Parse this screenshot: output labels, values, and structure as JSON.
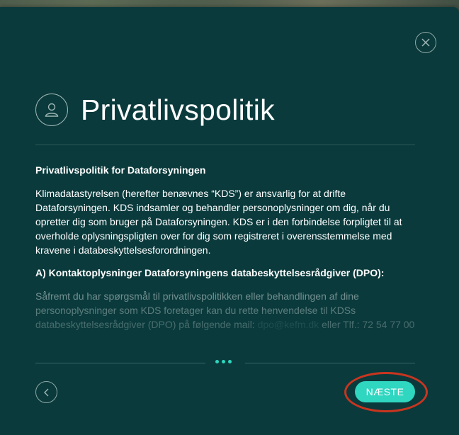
{
  "dialog": {
    "title": "Privatlivspolitik",
    "close_icon": "close-icon",
    "user_icon": "user-icon"
  },
  "content": {
    "heading": "Privatlivspolitik for Dataforsyningen",
    "paragraph1": "Klimadatastyrelsen (herefter benævnes “KDS”) er ansvarlig for at drifte Dataforsyningen. KDS indsamler og behandler personoplysninger om dig, når du opretter dig som bruger på Dataforsyningen. KDS er i den forbindelse forpligtet til at overholde oplysningspligten over for dig som registreret i overensstemmelse med kravene i databeskyttelsesforordningen.",
    "section_a_heading": "A) Kontaktoplysninger Dataforsyningens databeskyttelsesrådgiver (DPO):",
    "paragraph2_start": "Såfremt du har spørgsmål til privatlivspolitikken eller behandlingen af dine personoplysninger som KDS foretager kan du rette henvendelse til KDSs databeskyttelsesrådgiver (DPO) på følgende mail: ",
    "paragraph2_mail": "dpo@kefm.dk",
    "paragraph2_end": " eller Tlf.: 72 54 77 00"
  },
  "footer": {
    "back_icon": "chevron-left-icon",
    "next_label": "NÆSTE",
    "pagination_dots": 3
  },
  "colors": {
    "modal_bg": "#0a3a3c",
    "accent": "#2fd6c0",
    "highlight": "#c8351f"
  }
}
